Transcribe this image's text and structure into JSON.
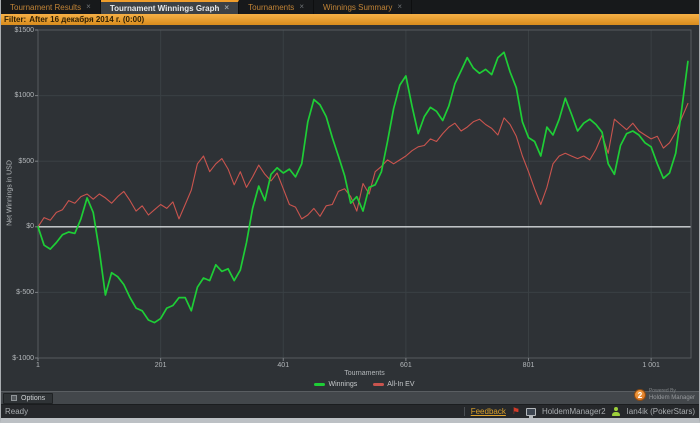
{
  "tab_bar": {
    "close_glyph": "×",
    "tabs": [
      {
        "id": "tournament-results",
        "label": "Tournament Results",
        "active": false
      },
      {
        "id": "tournament-winnings-graph",
        "label": "Tournament Winnings Graph",
        "active": true
      },
      {
        "id": "tournaments",
        "label": "Tournaments",
        "active": false
      },
      {
        "id": "winnings-summary",
        "label": "Winnings Summary",
        "active": false
      }
    ]
  },
  "filter_bar": {
    "label": "Filter:",
    "value": "After 16 декабря 2014 г. (0:00)"
  },
  "chart_data": {
    "type": "line",
    "title": "",
    "xlabel": "Tournaments",
    "ylabel": "Net Winnings in USD",
    "xlim": [
      1,
      1066
    ],
    "ylim": [
      -1000,
      1500
    ],
    "grid": true,
    "zero_line_highlighted": true,
    "x_ticks": [
      1,
      201,
      401,
      601,
      801,
      1001
    ],
    "x_tick_labels": [
      "1",
      "201",
      "401",
      "601",
      "801",
      "1 001"
    ],
    "y_ticks": [
      1500,
      1000,
      500,
      0,
      -500,
      -1000
    ],
    "y_tick_labels": [
      "$1500",
      "$1000",
      "$500",
      "$0",
      "$-500",
      "$-1000"
    ],
    "legend_position": "bottom-center",
    "legend": [
      {
        "name": "Winnings",
        "color": "#1ece36"
      },
      {
        "name": "All-In EV",
        "color": "#c9544e"
      }
    ],
    "x": [
      1,
      11,
      21,
      31,
      41,
      51,
      61,
      71,
      81,
      91,
      101,
      111,
      121,
      131,
      141,
      151,
      161,
      171,
      181,
      191,
      201,
      211,
      221,
      231,
      241,
      251,
      261,
      271,
      281,
      291,
      301,
      311,
      321,
      331,
      341,
      351,
      361,
      371,
      381,
      391,
      401,
      411,
      421,
      431,
      441,
      451,
      461,
      471,
      481,
      491,
      501,
      511,
      521,
      531,
      541,
      551,
      561,
      571,
      581,
      591,
      601,
      611,
      621,
      631,
      641,
      651,
      661,
      671,
      681,
      691,
      701,
      711,
      721,
      731,
      741,
      751,
      761,
      771,
      781,
      791,
      801,
      811,
      821,
      831,
      841,
      851,
      861,
      871,
      881,
      891,
      901,
      911,
      921,
      931,
      941,
      951,
      961,
      971,
      981,
      991,
      1001,
      1011,
      1021,
      1031,
      1041,
      1051,
      1061
    ],
    "series": [
      {
        "name": "Winnings",
        "color": "#1ece36",
        "values": [
          0,
          -140,
          -170,
          -120,
          -60,
          -40,
          -50,
          60,
          220,
          110,
          -180,
          -520,
          -350,
          -380,
          -440,
          -540,
          -620,
          -640,
          -710,
          -730,
          -700,
          -620,
          -600,
          -540,
          -540,
          -640,
          -460,
          -390,
          -410,
          -290,
          -340,
          -320,
          -410,
          -330,
          -120,
          140,
          310,
          200,
          400,
          450,
          410,
          440,
          380,
          480,
          800,
          970,
          930,
          840,
          680,
          540,
          390,
          180,
          230,
          120,
          300,
          320,
          420,
          650,
          900,
          1080,
          1150,
          920,
          710,
          840,
          910,
          880,
          810,
          920,
          1090,
          1190,
          1290,
          1210,
          1170,
          1200,
          1160,
          1290,
          1330,
          1180,
          1060,
          800,
          680,
          650,
          540,
          760,
          700,
          820,
          980,
          860,
          730,
          790,
          820,
          780,
          720,
          480,
          400,
          620,
          710,
          730,
          700,
          640,
          610,
          480,
          370,
          410,
          560,
          900,
          1260
        ]
      },
      {
        "name": "All-In EV",
        "color": "#c9544e",
        "values": [
          0,
          70,
          50,
          110,
          130,
          200,
          180,
          230,
          250,
          210,
          250,
          220,
          180,
          230,
          270,
          200,
          120,
          160,
          90,
          130,
          170,
          140,
          190,
          60,
          170,
          280,
          480,
          540,
          420,
          480,
          520,
          440,
          320,
          420,
          300,
          380,
          470,
          400,
          350,
          410,
          290,
          170,
          150,
          60,
          90,
          140,
          80,
          160,
          170,
          270,
          290,
          230,
          120,
          330,
          250,
          420,
          460,
          510,
          480,
          510,
          540,
          580,
          610,
          620,
          670,
          650,
          710,
          760,
          790,
          730,
          760,
          800,
          820,
          780,
          750,
          700,
          830,
          780,
          690,
          540,
          420,
          290,
          170,
          300,
          480,
          540,
          560,
          540,
          520,
          540,
          510,
          590,
          700,
          560,
          820,
          780,
          740,
          790,
          730,
          700,
          670,
          690,
          600,
          640,
          720,
          830,
          940
        ]
      }
    ]
  },
  "powered_by": {
    "line1": "Powered By",
    "line2": "Holdem Manager",
    "badge": "2"
  },
  "options_bar": {
    "options_label": "Options"
  },
  "status_bar": {
    "ready": "Ready",
    "feedback": "Feedback",
    "app_name": "HoldemManager2",
    "account": "Ian4ik (PokerStars)"
  },
  "colors": {
    "accent_orange": "#ef9d2b",
    "filter_bar_orange": "#eda438",
    "winnings_green": "#1ece36",
    "allin_ev_red": "#c9544e",
    "panel_bg": "#2e3236",
    "zero_line": "#d4d8db"
  }
}
